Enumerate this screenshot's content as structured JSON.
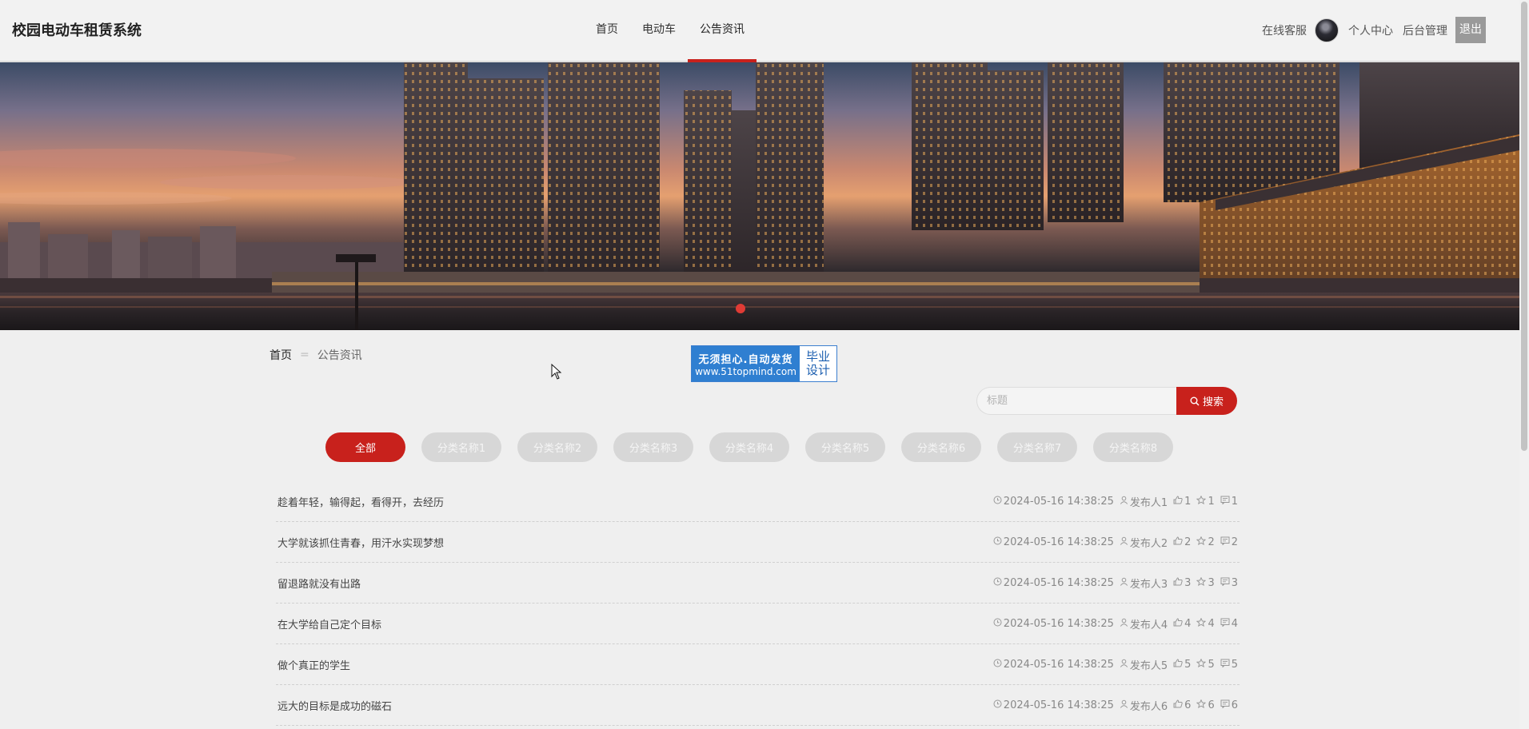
{
  "header": {
    "site_title": "校园电动车租赁系统",
    "nav": [
      "首页",
      "电动车",
      "公告资讯"
    ],
    "nav_active": 2,
    "right": {
      "service": "在线客服",
      "profile": "个人中心",
      "admin": "后台管理",
      "logout": "退出"
    }
  },
  "breadcrumb": {
    "home": "首页",
    "separator": "=",
    "current": "公告资讯"
  },
  "watermark": {
    "line1": "无须担心.自动发货",
    "line2": "www.51topmind.com",
    "right1": "毕业",
    "right2": "设计"
  },
  "search": {
    "placeholder": "标题",
    "button": "搜索"
  },
  "tags": [
    "全部",
    "分类名称1",
    "分类名称2",
    "分类名称3",
    "分类名称4",
    "分类名称5",
    "分类名称6",
    "分类名称7",
    "分类名称8"
  ],
  "tags_active": 0,
  "news": [
    {
      "title": "趁着年轻，输得起，看得开，去经历",
      "time": "2024-05-16 14:38:25",
      "author": "发布人1",
      "likes": "1",
      "favs": "1",
      "comments": "1"
    },
    {
      "title": "大学就该抓住青春，用汗水实现梦想",
      "time": "2024-05-16 14:38:25",
      "author": "发布人2",
      "likes": "2",
      "favs": "2",
      "comments": "2"
    },
    {
      "title": "留退路就没有出路",
      "time": "2024-05-16 14:38:25",
      "author": "发布人3",
      "likes": "3",
      "favs": "3",
      "comments": "3"
    },
    {
      "title": "在大学给自己定个目标",
      "time": "2024-05-16 14:38:25",
      "author": "发布人4",
      "likes": "4",
      "favs": "4",
      "comments": "4"
    },
    {
      "title": "做个真正的学生",
      "time": "2024-05-16 14:38:25",
      "author": "发布人5",
      "likes": "5",
      "favs": "5",
      "comments": "5"
    },
    {
      "title": "远大的目标是成功的磁石",
      "time": "2024-05-16 14:38:25",
      "author": "发布人6",
      "likes": "6",
      "favs": "6",
      "comments": "6"
    }
  ],
  "colors": {
    "accent": "#c8211c",
    "tag_inactive": "#d7d7d7",
    "background": "#efefef"
  },
  "icons": [
    "clock-icon",
    "user-icon",
    "thumb-up-icon",
    "star-icon",
    "comment-icon",
    "search-icon",
    "cursor-icon"
  ]
}
